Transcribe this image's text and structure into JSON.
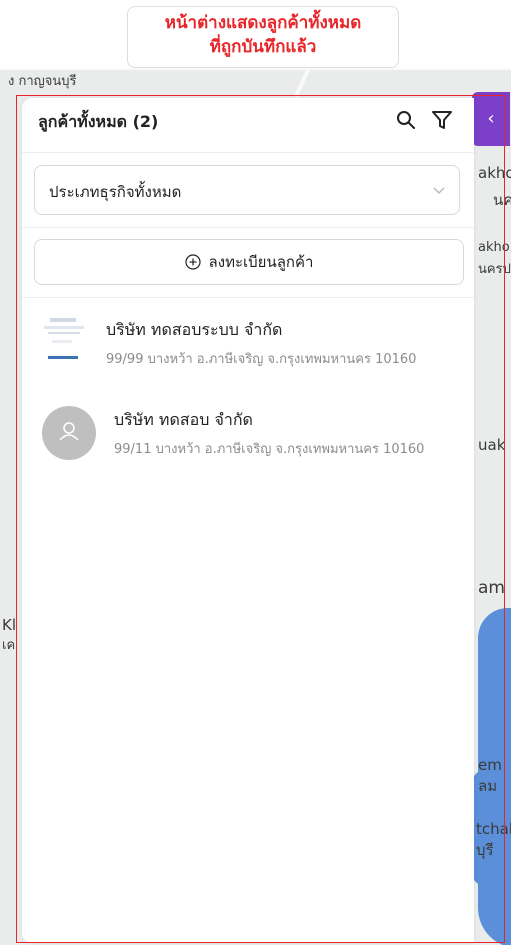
{
  "annotation": {
    "line1": "หน้าต่างแสดงลูกค้าทั้งหมด",
    "line2": "ที่ถูกบันทึกแล้ว"
  },
  "map_labels": {
    "top_left": "ง กาญจนบุรี",
    "right_1": "akho",
    "right_2": "นค",
    "right_3": "akho",
    "right_4": "นครป",
    "right_5": "uak",
    "right_6": "am",
    "right_7": "em",
    "right_8": "ลม",
    "right_9": "tchab",
    "right_10": "บุรี",
    "left_1": "Kl",
    "left_2": "เค"
  },
  "panel": {
    "title": "ลูกค้าทั้งหมด (2)",
    "business_type_select": {
      "value": "ประเภทธุรกิจทั้งหมด"
    },
    "register_button_label": "ลงทะเบียนลูกค้า",
    "customers": [
      {
        "name": "บริษัท ทดสอบระบบ จำกัด",
        "address": "99/99 บางหว้า อ.ภาษีเจริญ จ.กรุงเทพมหานคร 10160",
        "avatar": "company-logo"
      },
      {
        "name": "บริษัท ทดสอบ จำกัด",
        "address": "99/11 บางหว้า อ.ภาษีเจริญ จ.กรุงเทพมหานคร 10160",
        "avatar": "user-placeholder-icon"
      }
    ]
  },
  "icons": {
    "search": "search-icon",
    "filter": "filter-icon",
    "chevron": "chevron-down-icon",
    "add": "plus-circle-icon",
    "collapse": "chevron-left-icon"
  },
  "colors": {
    "annotation": "#e8262a",
    "tab": "#7b3fc9",
    "water": "#5b8fd9"
  }
}
